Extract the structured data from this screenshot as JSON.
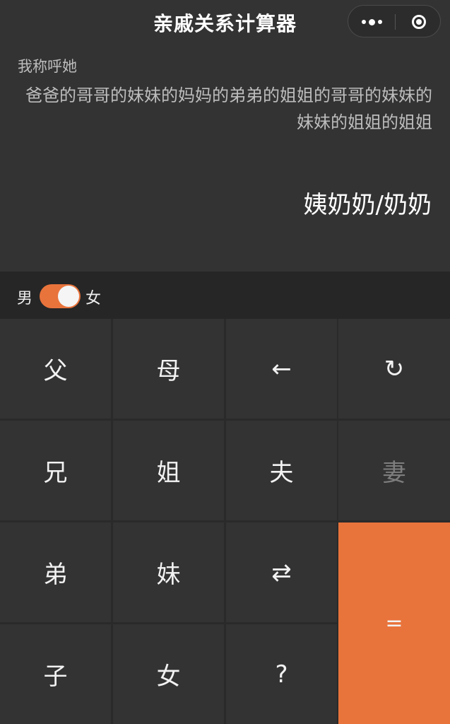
{
  "nav": {
    "title": "亲戚关系计算器",
    "more_icon": "more-dots-icon",
    "close_icon": "target-icon"
  },
  "display": {
    "label": "我称呼她",
    "expression": "爸爸的哥哥的妹妹的妈妈的弟弟的姐姐的哥哥的妹妹的妹妹的姐姐的姐姐",
    "result": "姨奶奶/奶奶"
  },
  "gender": {
    "male_label": "男",
    "female_label": "女",
    "selected": "女",
    "accent": "#e8743c"
  },
  "keys": {
    "father": "父",
    "mother": "母",
    "backspace": "←",
    "reset": "↻",
    "older_brother": "兄",
    "older_sister": "姐",
    "husband": "夫",
    "wife": "妻",
    "younger_brother": "弟",
    "younger_sister": "妹",
    "swap": "⇄",
    "equals": "=",
    "son": "子",
    "daughter": "女",
    "question": "?"
  }
}
